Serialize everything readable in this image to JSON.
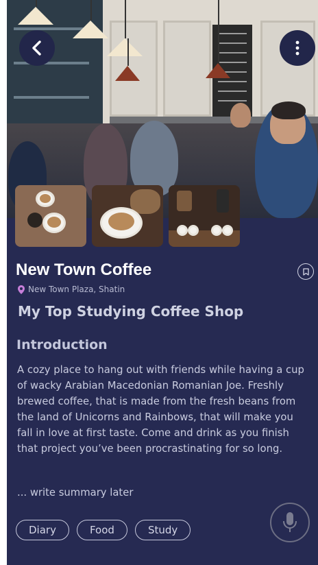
{
  "header": {
    "back_icon": "chevron-left-icon",
    "more_icon": "vertical-dots-icon"
  },
  "shop": {
    "name": "New Town Coffee",
    "location": "New Town Plaza, Shatin",
    "location_icon": "map-pin-icon",
    "bookmark_icon": "bookmark-icon"
  },
  "article": {
    "title": "My Top Studying Coffee Shop",
    "intro_heading": "Introduction",
    "intro_text": "A cozy place to hang out with friends while having a cup of wacky Arabian Macedonian Romanian Joe. Freshly brewed coffee, that is made from the fresh beans from the land of Unicorns and Rainbows, that will make you fall in love at first taste. Come and drink as you finish that project you’ve been procrastinating for so long.",
    "summary": "... write summary later"
  },
  "tags": [
    "Diary",
    "Food",
    "Study"
  ],
  "mic_icon": "microphone-icon",
  "colors": {
    "background": "#262a52",
    "pin": "#c77fd9"
  }
}
